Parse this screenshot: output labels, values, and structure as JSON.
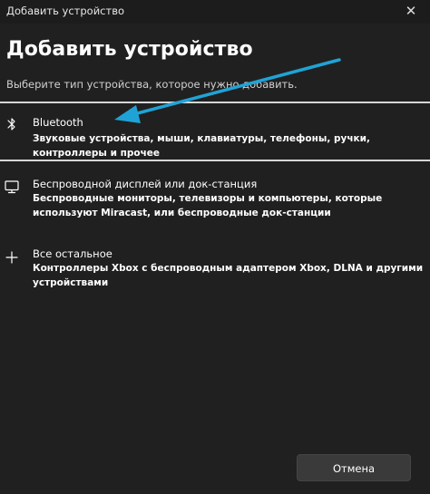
{
  "window": {
    "title": "Добавить устройство",
    "close_glyph": "✕"
  },
  "heading": "Добавить устройство",
  "subtitle": "Выберите тип устройства, которое нужно добавить.",
  "options": [
    {
      "icon": "bluetooth-icon",
      "title": "Bluetooth",
      "description": "Звуковые устройства, мыши, клавиатуры, телефоны, ручки, контроллеры и прочее",
      "selected": true
    },
    {
      "icon": "monitor-icon",
      "title": "Беспроводной дисплей или док-станция",
      "description": "Беспроводные мониторы, телевизоры и компьютеры, которые используют Miracast, или беспроводные док-станции"
    },
    {
      "icon": "plus-icon",
      "title": "Все остальное",
      "description": "Контроллеры Xbox с беспроводным адаптером Xbox, DLNA и другими устройствами"
    }
  ],
  "footer": {
    "cancel_label": "Отмена"
  },
  "colors": {
    "background": "#202020",
    "annotation_arrow": "#1fa3d6",
    "selection_border": "#d6d6d6"
  }
}
